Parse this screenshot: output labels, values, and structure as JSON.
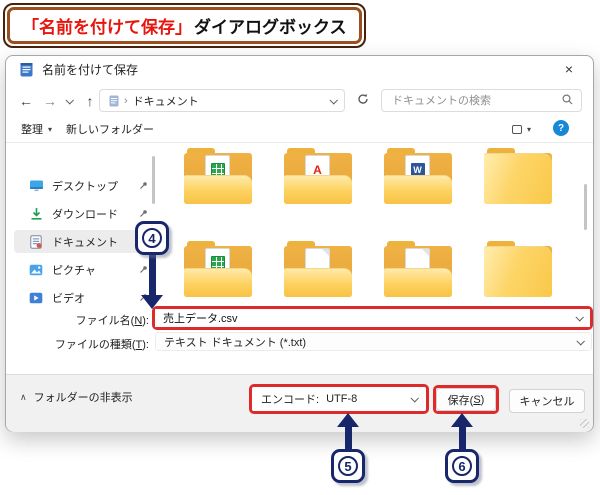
{
  "banner": {
    "title_quoted": "「名前を付けて保存」",
    "title_rest": "ダイアログボックス"
  },
  "glyphs": {
    "back": "←",
    "forward": "→",
    "up": "↑",
    "close": "×",
    "caret": "▾",
    "breadcrumb": "›",
    "chevron_up": "∧",
    "help": "?"
  },
  "window": {
    "title": "名前を付けて保存",
    "nav": {
      "location": "ドキュメント",
      "search_placeholder": "ドキュメントの検索"
    },
    "toolbar": {
      "organize_label": "整理",
      "new_folder_label": "新しいフォルダー"
    },
    "sidebar": {
      "items": [
        {
          "label": "デスクトップ",
          "icon": "desktop-icon",
          "pinned": true,
          "selected": false
        },
        {
          "label": "ダウンロード",
          "icon": "download-icon",
          "pinned": true,
          "selected": false
        },
        {
          "label": "ドキュメント",
          "icon": "documents-icon",
          "pinned": true,
          "selected": true
        },
        {
          "label": "ピクチャ",
          "icon": "pictures-icon",
          "pinned": true,
          "selected": false
        },
        {
          "label": "ビデオ",
          "icon": "videos-icon",
          "pinned": true,
          "selected": false
        }
      ]
    },
    "file_grid": {
      "items": [
        {
          "type": "excel"
        },
        {
          "type": "pdf"
        },
        {
          "type": "word"
        },
        {
          "type": "empty"
        },
        {
          "type": "excel"
        },
        {
          "type": "doc"
        },
        {
          "type": "doc"
        },
        {
          "type": "empty"
        }
      ],
      "overlay_labels": {
        "pdf": "A",
        "word": "W"
      }
    },
    "fields": {
      "file_name_label_pre": "ファイル名(",
      "file_name_mnemonic": "N",
      "file_name_label_post": "):",
      "file_name_value": "売上データ.csv",
      "file_type_label_pre": "ファイルの種類(",
      "file_type_mnemonic": "T",
      "file_type_label_post": "):",
      "file_type_value": "テキスト ドキュメント (*.txt)"
    },
    "footer": {
      "hide_folders_label": "フォルダーの非表示",
      "encoding_label": "エンコード:",
      "encoding_value": "UTF-8",
      "save_label_pre": "保存(",
      "save_mnemonic": "S",
      "save_label_post": ")",
      "cancel_label": "キャンセル"
    }
  },
  "callouts": {
    "step4": "4",
    "step5": "5",
    "step6": "6"
  },
  "colors": {
    "annotation_red": "#dd2b2b",
    "callout_navy": "#18266b",
    "banner_text_red": "#e8150d",
    "banner_border_brown": "#9c4f1f",
    "help_blue": "#1788d8",
    "folder_yellow": "#fdd15e",
    "selection_gray": "#ececec"
  }
}
